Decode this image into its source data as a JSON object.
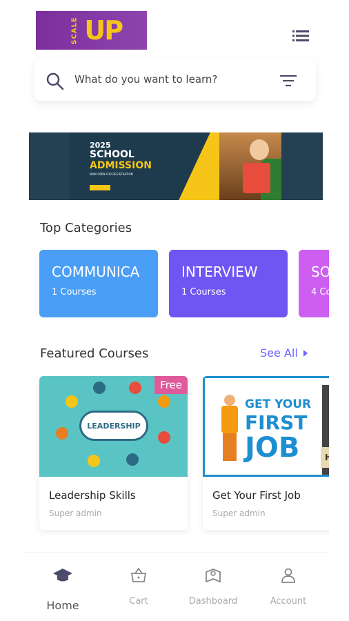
{
  "header": {
    "logo_text_small": "SCALE",
    "logo_text_big": "UP"
  },
  "search": {
    "placeholder": "What do you want to learn?"
  },
  "banner": {
    "year": "2025",
    "line1": "SCHOOL",
    "line2": "ADMISSION",
    "subline": "NOW OPEN FOR REGISTRATION"
  },
  "categories": {
    "title": "Top Categories",
    "items": [
      {
        "name": "COMMUNICA",
        "count": "1 Courses",
        "color": "#4a9ef5"
      },
      {
        "name": "INTERVIEW",
        "count": "1 Courses",
        "color": "#6f55f2"
      },
      {
        "name": "SO",
        "count": "4 Co",
        "color": "#cc5ff0"
      }
    ]
  },
  "featured": {
    "title": "Featured Courses",
    "see_all": "See All",
    "courses": [
      {
        "title": "Leadership Skills",
        "author": "Super admin",
        "badge": "Free",
        "thumb_text": "LEADERSHIP"
      },
      {
        "title": "Get Your First Job",
        "author": "Super admin",
        "thumb_line1": "GET YOUR",
        "thumb_line2": "FIRST",
        "thumb_line3": "JOB",
        "thumb_sign": "HIRE"
      }
    ]
  },
  "nav": {
    "items": [
      {
        "label": "Home",
        "icon": "graduation-cap-icon",
        "active": true
      },
      {
        "label": "Cart",
        "icon": "basket-icon",
        "active": false
      },
      {
        "label": "Dashboard",
        "icon": "dashboard-icon",
        "active": false
      },
      {
        "label": "Account",
        "icon": "user-icon",
        "active": false
      }
    ]
  },
  "colors": {
    "accent": "#6c63ff",
    "logo_bg": "#8e44ad",
    "badge": "#e05a9b"
  }
}
